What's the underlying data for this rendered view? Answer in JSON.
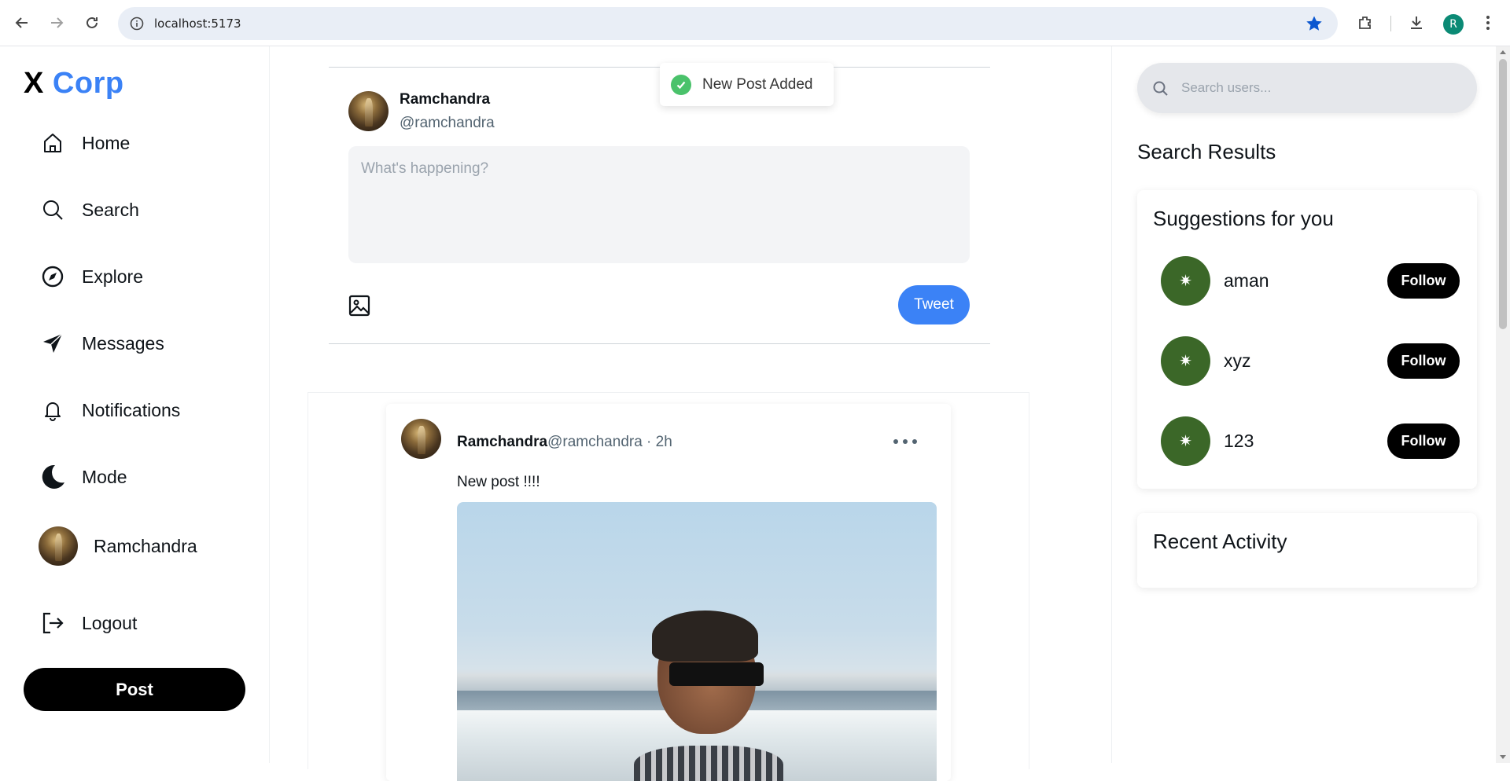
{
  "browser": {
    "url": "localhost:5173",
    "profile_initial": "R"
  },
  "app": {
    "logo_x": "X",
    "logo_corp": "Corp"
  },
  "sidebar": {
    "items": [
      {
        "label": "Home",
        "icon": "home-icon"
      },
      {
        "label": "Search",
        "icon": "search-icon"
      },
      {
        "label": "Explore",
        "icon": "compass-icon"
      },
      {
        "label": "Messages",
        "icon": "send-icon"
      },
      {
        "label": "Notifications",
        "icon": "bell-icon"
      },
      {
        "label": "Mode",
        "icon": "moon-icon"
      },
      {
        "label": "Ramchandra",
        "icon": "avatar"
      },
      {
        "label": "Logout",
        "icon": "logout-icon"
      }
    ],
    "post_label": "Post"
  },
  "composer": {
    "name": "Ramchandra",
    "handle": "@ramchandra",
    "placeholder": "What's happening?",
    "tweet_label": "Tweet"
  },
  "toast": {
    "message": "New Post Added"
  },
  "post": {
    "name": "Ramchandra",
    "handle": "@ramchandra",
    "time": " · 2h",
    "text": "New post !!!!"
  },
  "right": {
    "search_placeholder": "Search users...",
    "search_results_title": "Search Results",
    "suggestions_title": "Suggestions for you",
    "suggestions": [
      {
        "name": "aman",
        "button": "Follow"
      },
      {
        "name": "xyz",
        "button": "Follow"
      },
      {
        "name": "123",
        "button": "Follow"
      }
    ],
    "recent_activity_title": "Recent Activity"
  },
  "colors": {
    "accent": "#3b82f6",
    "toast_success": "#4ac26b",
    "suggestion_avatar": "#3b6728"
  }
}
